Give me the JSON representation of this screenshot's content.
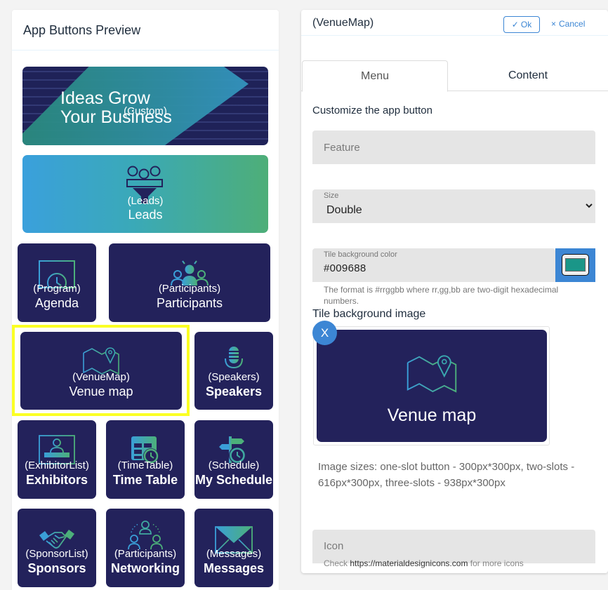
{
  "left": {
    "title": "App Buttons Preview",
    "tiles": [
      {
        "id": "custom",
        "code": "(Custom)",
        "headline": [
          "Ideas Grow",
          "Your Business"
        ],
        "icon": "banner-image"
      },
      {
        "id": "leads",
        "code": "(Leads)",
        "label": "Leads",
        "icon": "funnel-icon"
      },
      {
        "id": "program",
        "code": "(Program)",
        "label": "Agenda",
        "icon": "calendar-clock-icon"
      },
      {
        "id": "participants",
        "code": "(Participants)",
        "label": "Participants",
        "icon": "people-group-icon"
      },
      {
        "id": "venuemap",
        "code": "(VenueMap)",
        "label": "Venue map",
        "icon": "map-pin-icon",
        "selected": true
      },
      {
        "id": "speakers",
        "code": "(Speakers)",
        "label": "Speakers",
        "icon": "microphone-icon"
      },
      {
        "id": "exhibitorlist",
        "code": "(ExhibitorList)",
        "label": "Exhibitors",
        "icon": "exhibitor-booth-icon"
      },
      {
        "id": "timetable",
        "code": "(TimeTable)",
        "label": "Time Table",
        "icon": "table-clock-icon"
      },
      {
        "id": "schedule",
        "code": "(Schedule)",
        "label": "My Schedule",
        "icon": "signpost-clock-icon"
      },
      {
        "id": "sponsorlist",
        "code": "(SponsorList)",
        "label": "Sponsors",
        "icon": "handshake-icon"
      },
      {
        "id": "networking",
        "code": "(Participants)",
        "label": "Networking",
        "icon": "network-people-icon"
      },
      {
        "id": "messages",
        "code": "(Messages)",
        "label": "Messages",
        "icon": "envelope-icon"
      }
    ]
  },
  "right": {
    "title": "(VenueMap)",
    "ok_label": "Ok",
    "cancel_label": "Cancel",
    "tabs": [
      {
        "label": "Menu",
        "active": true
      },
      {
        "label": "Content",
        "active": false
      }
    ],
    "section_title": "Customize the app button",
    "feature": {
      "placeholder": "Feature",
      "value": ""
    },
    "size": {
      "label": "Size",
      "value": "Double"
    },
    "color": {
      "label": "Tile background color",
      "value": "#009688",
      "hint": "The format is #rrggbb where rr,gg,bb are two-digit hexadecimal numbers."
    },
    "background_image": {
      "label": "Tile background image",
      "remove_label": "X",
      "preview_label": "Venue map"
    },
    "image_sizes_note": "Image sizes: one-slot button - 300px*300px, two-slots - 616px*300px, three-slots - 938px*300px",
    "icon_field": {
      "placeholder": "Icon",
      "value": ""
    },
    "icon_hint": {
      "prefix": "Check",
      "link": "https://materialdesignicons.com",
      "suffix": "for more icons"
    }
  },
  "colors": {
    "tile_bg": "#23225b",
    "accent_blue": "#3c86d4",
    "highlight": "#fbff24",
    "gradient_start": "#3aa0dc",
    "gradient_end": "#4eae78",
    "swatch": "#1a9688"
  }
}
